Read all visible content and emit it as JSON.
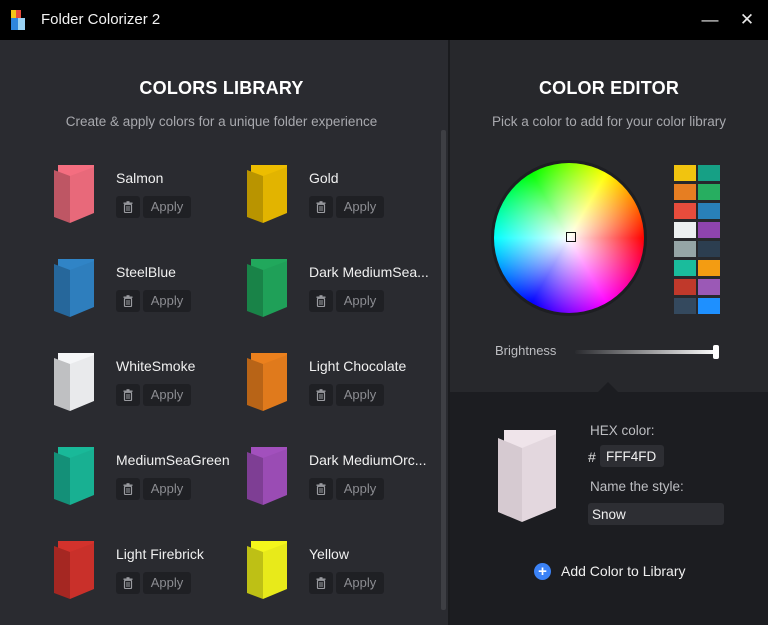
{
  "window": {
    "title": "Folder Colorizer 2",
    "minimize_glyph": "—",
    "close_glyph": "✕",
    "icon": "folder-colorizer-app-icon"
  },
  "library": {
    "title": "COLORS LIBRARY",
    "subtitle": "Create & apply colors for a unique folder experience",
    "apply_label": "Apply",
    "delete_icon": "trash-icon",
    "items": [
      {
        "name": "Salmon",
        "color": "#e8697a"
      },
      {
        "name": "Gold",
        "color": "#e2b400"
      },
      {
        "name": "SteelBlue",
        "color": "#2e7ebd"
      },
      {
        "name": "Dark MediumSea...",
        "color": "#1fa058"
      },
      {
        "name": "WhiteSmoke",
        "color": "#e9eaec"
      },
      {
        "name": "Light Chocolate",
        "color": "#e07a1c"
      },
      {
        "name": "MediumSeaGreen",
        "color": "#18b092"
      },
      {
        "name": "Dark MediumOrc...",
        "color": "#9a4cb4"
      },
      {
        "name": "Light Firebrick",
        "color": "#c9302a"
      },
      {
        "name": "Yellow",
        "color": "#e8ea1a"
      }
    ]
  },
  "editor": {
    "title": "COLOR EDITOR",
    "subtitle": "Pick a color to add for your color library",
    "swatches": [
      "#f1c40f",
      "#16a085",
      "#e67e22",
      "#27ae60",
      "#e74c3c",
      "#2980b9",
      "#ecf0f1",
      "#8e44ad",
      "#95a5a6",
      "#2c3e50",
      "#1abc9c",
      "#f39c12",
      "#c0392b",
      "#9b59b6",
      "#34495e",
      "#1e90ff"
    ],
    "brightness_label": "Brightness",
    "brightness_value": 1.0,
    "hex_label": "HEX color:",
    "hex_prefix": "#",
    "hex_value": "FFF4FD",
    "name_label": "Name the style:",
    "name_value": "Snow",
    "preview_color": "#e8dde4",
    "add_label": "Add Color to Library",
    "add_icon": "plus-circle-icon"
  }
}
